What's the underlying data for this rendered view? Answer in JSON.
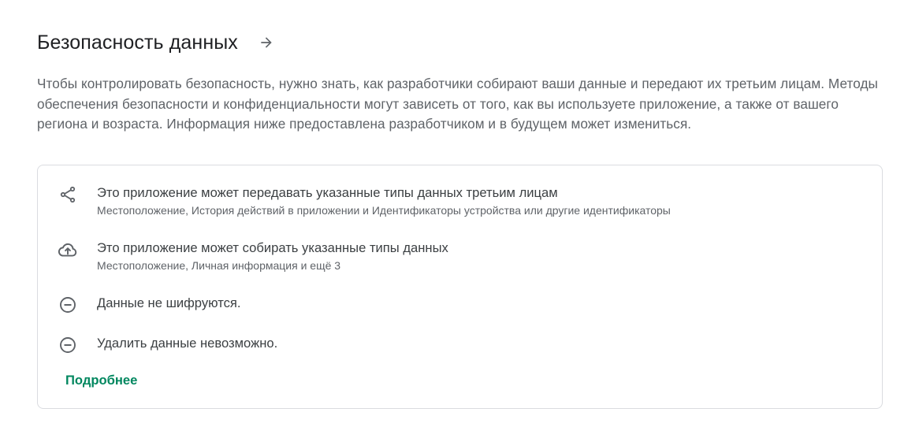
{
  "section": {
    "title": "Безопасность данных",
    "intro": "Чтобы контролировать безопасность, нужно знать, как разработчики собирают ваши данные и передают их третьим лицам. Методы обеспечения безопасности и конфиденциальности могут зависеть от того, как вы используете приложение, а также от вашего региона и возраста. Информация ниже предоставлена разработчиком и в будущем может измениться."
  },
  "items": [
    {
      "icon": "share-icon",
      "title": "Это приложение может передавать указанные типы данных третьим лицам",
      "subtitle": "Местоположение, История действий в приложении и Идентификаторы устройства или другие идентификаторы"
    },
    {
      "icon": "cloud-upload-icon",
      "title": "Это приложение может собирать указанные типы данных",
      "subtitle": "Местоположение, Личная информация и ещё 3"
    },
    {
      "icon": "minus-circle-icon",
      "title": "Данные не шифруются."
    },
    {
      "icon": "minus-circle-icon",
      "title": "Удалить данные невозможно."
    }
  ],
  "more_link": "Подробнее",
  "colors": {
    "text": "#202124",
    "secondary_text": "#5f6368",
    "link": "#01875f",
    "border": "#dadce0",
    "icon": "#5f6368"
  }
}
